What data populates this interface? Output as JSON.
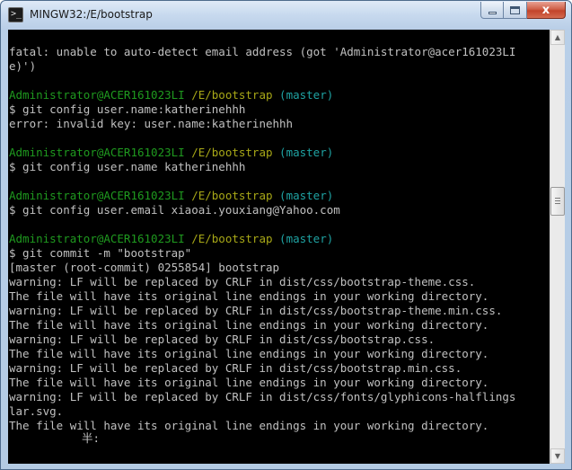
{
  "window": {
    "title": "MINGW32:/E/bootstrap",
    "icon": "terminal-icon",
    "icon_glyph": ">_",
    "buttons": {
      "minimize": "minimize-icon",
      "maximize": "maximize-icon",
      "close": "close-icon",
      "close_glyph": "x"
    }
  },
  "colors": {
    "console_background": "#000000",
    "console_text": "#c0c0c0",
    "prompt_user": "#1f9a1f",
    "prompt_path": "#a8a817",
    "prompt_branch": "#1fa3a3"
  },
  "console": {
    "lines": [
      {
        "type": "output",
        "text": "fatal: unable to auto-detect email address (got 'Administrator@acer161023LI"
      },
      {
        "type": "output",
        "text": "e)')"
      },
      {
        "type": "blank"
      },
      {
        "type": "prompt",
        "user": "Administrator@ACER161023LI",
        "path": "/E/bootstrap",
        "branch": "(master)"
      },
      {
        "type": "command",
        "text": "$ git config user.name:katherinehhh"
      },
      {
        "type": "output",
        "text": "error: invalid key: user.name:katherinehhh"
      },
      {
        "type": "blank"
      },
      {
        "type": "prompt",
        "user": "Administrator@ACER161023LI",
        "path": "/E/bootstrap",
        "branch": "(master)"
      },
      {
        "type": "command",
        "text": "$ git config user.name katherinehhh"
      },
      {
        "type": "blank"
      },
      {
        "type": "prompt",
        "user": "Administrator@ACER161023LI",
        "path": "/E/bootstrap",
        "branch": "(master)"
      },
      {
        "type": "command",
        "text": "$ git config user.email xiaoai.youxiang@Yahoo.com"
      },
      {
        "type": "blank"
      },
      {
        "type": "prompt",
        "user": "Administrator@ACER161023LI",
        "path": "/E/bootstrap",
        "branch": "(master)"
      },
      {
        "type": "command",
        "text": "$ git commit -m \"bootstrap\""
      },
      {
        "type": "output",
        "text": "[master (root-commit) 0255854] bootstrap"
      },
      {
        "type": "output",
        "text": "warning: LF will be replaced by CRLF in dist/css/bootstrap-theme.css."
      },
      {
        "type": "output",
        "text": "The file will have its original line endings in your working directory."
      },
      {
        "type": "output",
        "text": "warning: LF will be replaced by CRLF in dist/css/bootstrap-theme.min.css."
      },
      {
        "type": "output",
        "text": "The file will have its original line endings in your working directory."
      },
      {
        "type": "output",
        "text": "warning: LF will be replaced by CRLF in dist/css/bootstrap.css."
      },
      {
        "type": "output",
        "text": "The file will have its original line endings in your working directory."
      },
      {
        "type": "output",
        "text": "warning: LF will be replaced by CRLF in dist/css/bootstrap.min.css."
      },
      {
        "type": "output",
        "text": "The file will have its original line endings in your working directory."
      },
      {
        "type": "output",
        "text": "warning: LF will be replaced by CRLF in dist/css/fonts/glyphicons-halflings"
      },
      {
        "type": "output",
        "text": "lar.svg."
      },
      {
        "type": "output",
        "text": "The file will have its original line endings in your working directory."
      }
    ],
    "ime_indicator": "半:"
  },
  "scrollbar": {
    "up_icon": "scroll-up-arrow-icon",
    "down_icon": "scroll-down-arrow-icon",
    "up_glyph": "▲",
    "down_glyph": "▼",
    "position_fraction": 0.38
  }
}
